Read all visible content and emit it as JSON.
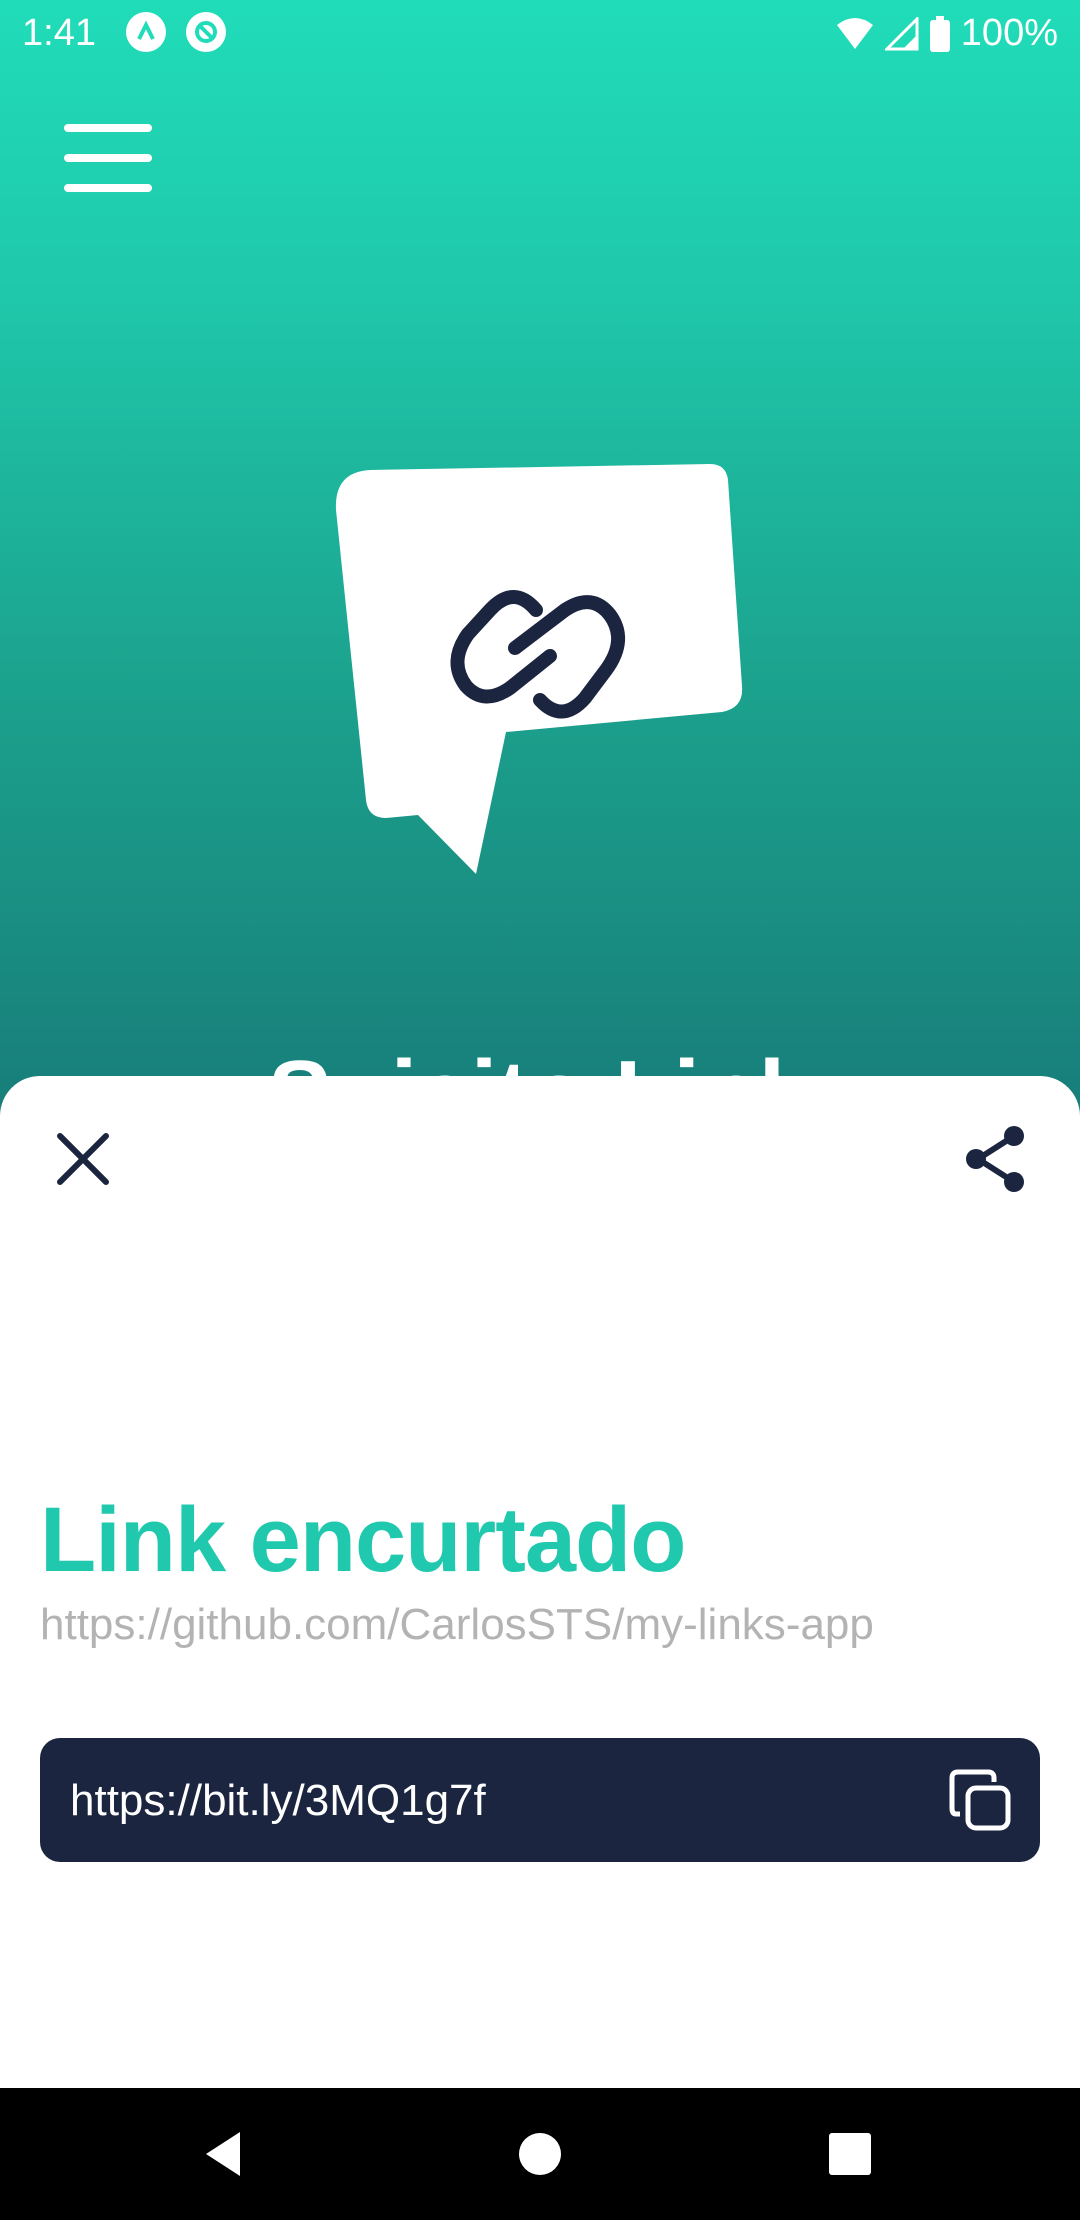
{
  "status_bar": {
    "time": "1:41",
    "battery": "100%",
    "icons": [
      "app-icon-a",
      "app-icon-b",
      "wifi-icon",
      "signal-icon",
      "battery-icon"
    ]
  },
  "header": {
    "menu_icon": "hamburger-menu-icon",
    "app_title_partial": "Sujeito Link"
  },
  "logo": {
    "icon": "chain-link-speech-bubble-logo"
  },
  "sheet": {
    "close_icon": "close-icon",
    "share_icon": "share-icon",
    "title": "Link encurtado",
    "original_url": "https://github.com/CarlosSTS/my-links-app",
    "short_link": "https://bit.ly/3MQ1g7f",
    "copy_icon": "copy-icon"
  },
  "colors": {
    "accent": "#20c9ad",
    "gradient_top": "#20dcb9",
    "gradient_bottom": "#187d79",
    "dark_box": "#1b2540",
    "muted_text": "#b3b3b3"
  },
  "nav_bar": {
    "back_icon": "back-icon",
    "home_icon": "home-icon",
    "recents_icon": "recents-icon"
  }
}
